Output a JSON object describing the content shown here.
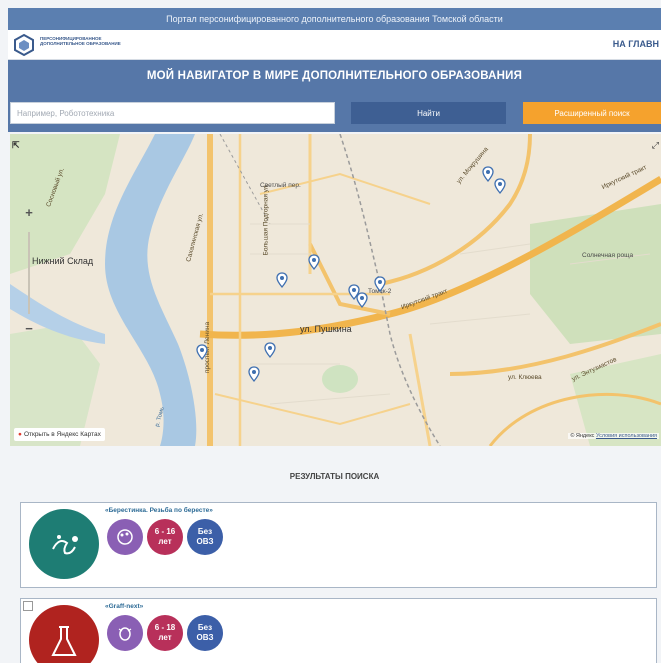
{
  "topbar": {
    "text": "Портал персонифицированного дополнительного образования Томской области"
  },
  "header": {
    "logo_text": "ПЕРСОНИФИЦИРОВАННОЕ ДОПОЛНИТЕЛЬНОЕ ОБРАЗОВАНИЕ",
    "nav_home": "НА ГЛАВН"
  },
  "hero": {
    "title": "МОЙ НАВИГАТОР В МИРЕ ДОПОЛНИТЕЛЬНОГО ОБРАЗОВАНИЯ",
    "search_placeholder": "Например, Робототехника",
    "find_label": "Найти",
    "advanced_label": "Расширенный поиск"
  },
  "map": {
    "labels": {
      "north_settlement": "Светлый пер.",
      "nizhny_sklad": "Нижний Склад",
      "irkutsky_trakt_upper": "Иркутский тракт",
      "irkutsky_trakt_lower": "Иркутский тракт",
      "pushkina": "ул. Пушкина",
      "mokrushina": "ул. Мокрушина",
      "solnechny": "Солнечная роща",
      "klyueva": "ул. Клюева",
      "entuziastov": "ул. Энтузиастов",
      "sovetskaya": "Сахалинская ул.",
      "lenina_ave": "пр. Ленина",
      "proletarsky": "проспект Ленина",
      "tom_river": "р. Томь",
      "station": "Томск-2",
      "vertical_street": "Большая Подгорная ул.",
      "river_upper": "Сосновый ул."
    },
    "geo_icon": "location-arrow-icon",
    "open_yandex": "Открыть в Яндекс Картах",
    "copyright_brand": "© Яндекс",
    "copyright_terms": "Условия использования",
    "zoom_plus": "+",
    "zoom_minus": "−"
  },
  "results": {
    "title": "РЕЗУЛЬТАТЫ ПОИСКА",
    "items": [
      {
        "title": "«Берестинка. Резьба по бересте»",
        "age_line1": "6 - 16",
        "age_line2": "лет",
        "ovz_line1": "Без",
        "ovz_line2": "ОВЗ",
        "avatar_color": "#1e7d74",
        "category_icon": "palette-icon"
      },
      {
        "title": "«Graff-next»",
        "age_line1": "6 - 18",
        "age_line2": "лет",
        "ovz_line1": "Без",
        "ovz_line2": "ОВЗ",
        "avatar_color": "#b0231f",
        "category_icon": "flask-icon"
      }
    ]
  }
}
